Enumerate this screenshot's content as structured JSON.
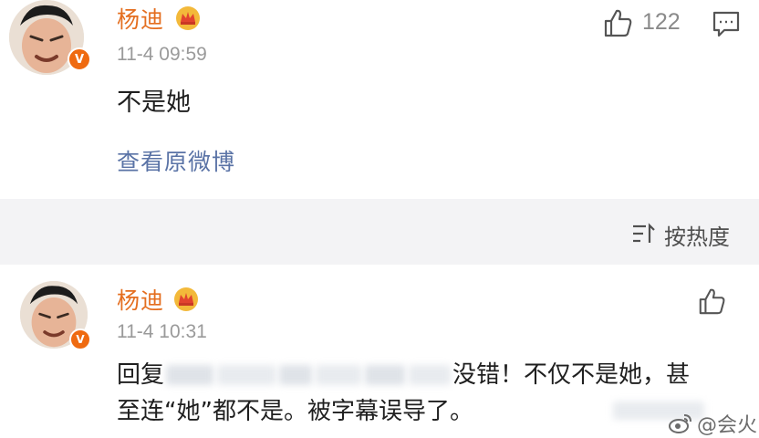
{
  "post": {
    "username": "杨迪",
    "timestamp": "11-4 09:59",
    "content": "不是她",
    "view_original": "查看原微博",
    "like_count": "122",
    "icons": {
      "avatar": "user-avatar",
      "verified": "verified-badge-icon",
      "crown": "crown-icon",
      "like": "thumbs-up-icon",
      "comment": "comment-icon"
    },
    "verified_label": "V"
  },
  "sort": {
    "label": "按热度",
    "icon": "sort-icon"
  },
  "reply": {
    "username": "杨迪",
    "timestamp": "11-4 10:31",
    "prefix": "回复",
    "line1_tail": "没错！不仅不是她，甚",
    "line2": "至连“她”都不是。被字幕误导了。",
    "verified_label": "V"
  },
  "watermark": {
    "text": "@会火",
    "icon": "weibo-logo-icon"
  },
  "colors": {
    "username": "#e46e1f",
    "link": "#5a73a6",
    "timestamp": "#9a9a9a",
    "badge": "#ef6a10",
    "band": "#f3f3f5"
  }
}
